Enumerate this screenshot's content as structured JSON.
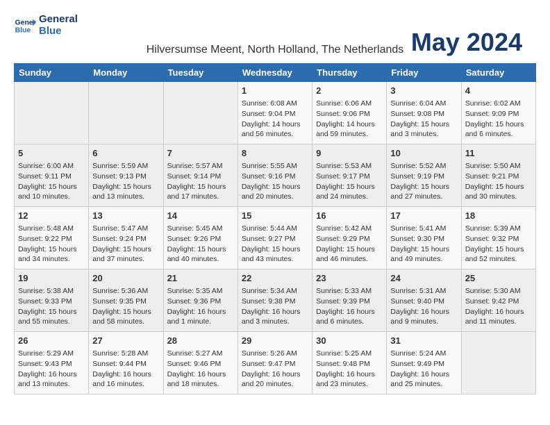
{
  "logo": {
    "line1": "General",
    "line2": "Blue"
  },
  "title": "May 2024",
  "location": "Hilversumse Meent, North Holland, The Netherlands",
  "days_of_week": [
    "Sunday",
    "Monday",
    "Tuesday",
    "Wednesday",
    "Thursday",
    "Friday",
    "Saturday"
  ],
  "weeks": [
    [
      {
        "day": "",
        "content": ""
      },
      {
        "day": "",
        "content": ""
      },
      {
        "day": "",
        "content": ""
      },
      {
        "day": "1",
        "content": "Sunrise: 6:08 AM\nSunset: 9:04 PM\nDaylight: 14 hours\nand 56 minutes."
      },
      {
        "day": "2",
        "content": "Sunrise: 6:06 AM\nSunset: 9:06 PM\nDaylight: 14 hours\nand 59 minutes."
      },
      {
        "day": "3",
        "content": "Sunrise: 6:04 AM\nSunset: 9:08 PM\nDaylight: 15 hours\nand 3 minutes."
      },
      {
        "day": "4",
        "content": "Sunrise: 6:02 AM\nSunset: 9:09 PM\nDaylight: 15 hours\nand 6 minutes."
      }
    ],
    [
      {
        "day": "5",
        "content": "Sunrise: 6:00 AM\nSunset: 9:11 PM\nDaylight: 15 hours\nand 10 minutes."
      },
      {
        "day": "6",
        "content": "Sunrise: 5:59 AM\nSunset: 9:13 PM\nDaylight: 15 hours\nand 13 minutes."
      },
      {
        "day": "7",
        "content": "Sunrise: 5:57 AM\nSunset: 9:14 PM\nDaylight: 15 hours\nand 17 minutes."
      },
      {
        "day": "8",
        "content": "Sunrise: 5:55 AM\nSunset: 9:16 PM\nDaylight: 15 hours\nand 20 minutes."
      },
      {
        "day": "9",
        "content": "Sunrise: 5:53 AM\nSunset: 9:17 PM\nDaylight: 15 hours\nand 24 minutes."
      },
      {
        "day": "10",
        "content": "Sunrise: 5:52 AM\nSunset: 9:19 PM\nDaylight: 15 hours\nand 27 minutes."
      },
      {
        "day": "11",
        "content": "Sunrise: 5:50 AM\nSunset: 9:21 PM\nDaylight: 15 hours\nand 30 minutes."
      }
    ],
    [
      {
        "day": "12",
        "content": "Sunrise: 5:48 AM\nSunset: 9:22 PM\nDaylight: 15 hours\nand 34 minutes."
      },
      {
        "day": "13",
        "content": "Sunrise: 5:47 AM\nSunset: 9:24 PM\nDaylight: 15 hours\nand 37 minutes."
      },
      {
        "day": "14",
        "content": "Sunrise: 5:45 AM\nSunset: 9:26 PM\nDaylight: 15 hours\nand 40 minutes."
      },
      {
        "day": "15",
        "content": "Sunrise: 5:44 AM\nSunset: 9:27 PM\nDaylight: 15 hours\nand 43 minutes."
      },
      {
        "day": "16",
        "content": "Sunrise: 5:42 AM\nSunset: 9:29 PM\nDaylight: 15 hours\nand 46 minutes."
      },
      {
        "day": "17",
        "content": "Sunrise: 5:41 AM\nSunset: 9:30 PM\nDaylight: 15 hours\nand 49 minutes."
      },
      {
        "day": "18",
        "content": "Sunrise: 5:39 AM\nSunset: 9:32 PM\nDaylight: 15 hours\nand 52 minutes."
      }
    ],
    [
      {
        "day": "19",
        "content": "Sunrise: 5:38 AM\nSunset: 9:33 PM\nDaylight: 15 hours\nand 55 minutes."
      },
      {
        "day": "20",
        "content": "Sunrise: 5:36 AM\nSunset: 9:35 PM\nDaylight: 15 hours\nand 58 minutes."
      },
      {
        "day": "21",
        "content": "Sunrise: 5:35 AM\nSunset: 9:36 PM\nDaylight: 16 hours\nand 1 minute."
      },
      {
        "day": "22",
        "content": "Sunrise: 5:34 AM\nSunset: 9:38 PM\nDaylight: 16 hours\nand 3 minutes."
      },
      {
        "day": "23",
        "content": "Sunrise: 5:33 AM\nSunset: 9:39 PM\nDaylight: 16 hours\nand 6 minutes."
      },
      {
        "day": "24",
        "content": "Sunrise: 5:31 AM\nSunset: 9:40 PM\nDaylight: 16 hours\nand 9 minutes."
      },
      {
        "day": "25",
        "content": "Sunrise: 5:30 AM\nSunset: 9:42 PM\nDaylight: 16 hours\nand 11 minutes."
      }
    ],
    [
      {
        "day": "26",
        "content": "Sunrise: 5:29 AM\nSunset: 9:43 PM\nDaylight: 16 hours\nand 13 minutes."
      },
      {
        "day": "27",
        "content": "Sunrise: 5:28 AM\nSunset: 9:44 PM\nDaylight: 16 hours\nand 16 minutes."
      },
      {
        "day": "28",
        "content": "Sunrise: 5:27 AM\nSunset: 9:46 PM\nDaylight: 16 hours\nand 18 minutes."
      },
      {
        "day": "29",
        "content": "Sunrise: 5:26 AM\nSunset: 9:47 PM\nDaylight: 16 hours\nand 20 minutes."
      },
      {
        "day": "30",
        "content": "Sunrise: 5:25 AM\nSunset: 9:48 PM\nDaylight: 16 hours\nand 23 minutes."
      },
      {
        "day": "31",
        "content": "Sunrise: 5:24 AM\nSunset: 9:49 PM\nDaylight: 16 hours\nand 25 minutes."
      },
      {
        "day": "",
        "content": ""
      }
    ]
  ]
}
